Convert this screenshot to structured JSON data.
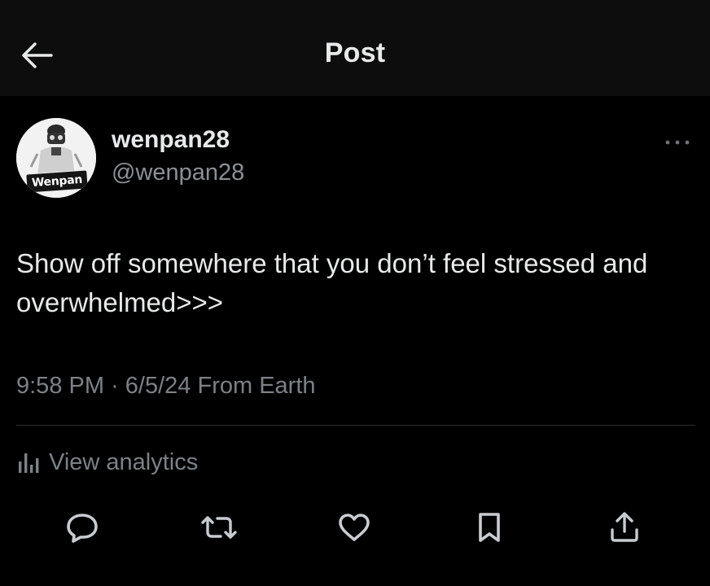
{
  "header": {
    "back_icon": "arrow-left-icon",
    "title": "Post"
  },
  "author": {
    "avatar_label": "Wenpan",
    "display_name": "wenpan28",
    "handle": "@wenpan28",
    "more_icon": "more-horizontal-icon"
  },
  "post": {
    "text": "Show off somewhere that you don’t feel stressed and overwhelmed>>>",
    "time": "9:58 PM",
    "separator": "·",
    "date": "6/5/24",
    "source": "From Earth"
  },
  "analytics": {
    "icon": "analytics-bars-icon",
    "label": "View analytics"
  },
  "actions": [
    {
      "name": "reply",
      "icon": "reply-bubble-icon"
    },
    {
      "name": "repost",
      "icon": "repost-icon"
    },
    {
      "name": "like",
      "icon": "heart-icon"
    },
    {
      "name": "bookmark",
      "icon": "bookmark-icon"
    },
    {
      "name": "share",
      "icon": "share-upload-icon"
    }
  ],
  "colors": {
    "background": "#000000",
    "header_background": "#0d0d0d",
    "primary_text": "#e7e9ea",
    "secondary_text": "#7c8186",
    "divider": "#2b2d30"
  }
}
